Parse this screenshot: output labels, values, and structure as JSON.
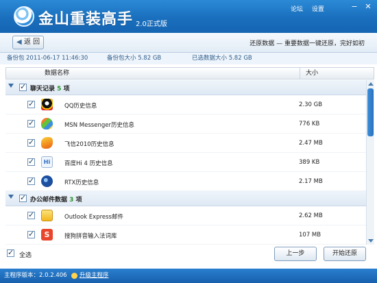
{
  "app": {
    "title": "金山重装高手",
    "version": "2.0正式版"
  },
  "top_links": {
    "forum": "论坛",
    "settings": "设置"
  },
  "window_buttons": {
    "minimize": "−",
    "close": "✕"
  },
  "nav": {
    "back_label": "返 回",
    "breadcrumb": "还原数据 — 重要数据一键还原，完好如初"
  },
  "info": {
    "backup_label": "备份包",
    "backup_date": "2011-06-17 11:46:30",
    "pack_size": "备份包大小 5.82 GB",
    "selected_size": "已选数据大小 5.82 GB"
  },
  "table": {
    "col_name": "数据名称",
    "col_size": "大小"
  },
  "groups": [
    {
      "label": "聊天记录",
      "count": "5",
      "unit": "项",
      "items": [
        {
          "name": "QQ历史信息",
          "size": "2.30 GB",
          "icon": "qq-penguin-icon",
          "color": "#222222"
        },
        {
          "name": "MSN Messenger历史信息",
          "size": "776 KB",
          "icon": "msn-butterfly-icon",
          "color": "#5aa0e0"
        },
        {
          "name": "飞信2010历史信息",
          "size": "2.47 MB",
          "icon": "fetion-icon",
          "color": "#f5a623"
        },
        {
          "name": "百度Hi 4 历史信息",
          "size": "389 KB",
          "icon": "baidu-hi-icon",
          "color": "#2b6cc4"
        },
        {
          "name": "RTX历史信息",
          "size": "2.17 MB",
          "icon": "rtx-icon",
          "color": "#1d4fa0"
        }
      ]
    },
    {
      "label": "办公邮件数据",
      "count": "3",
      "unit": "项",
      "items": [
        {
          "name": "Outlook Express邮件",
          "size": "2.62 MB",
          "icon": "outlook-express-icon",
          "color": "#f2c230"
        },
        {
          "name": "搜狗拼音输入法词库",
          "size": "107 MB",
          "icon": "sogou-input-icon",
          "color": "#e8452c"
        }
      ]
    }
  ],
  "footer": {
    "select_all": "全选",
    "prev_button": "上一步",
    "restore_button": "开始还原"
  },
  "status": {
    "program_version": "主程序版本：2.0.2.406",
    "upgrade_link": "升级主程序"
  }
}
